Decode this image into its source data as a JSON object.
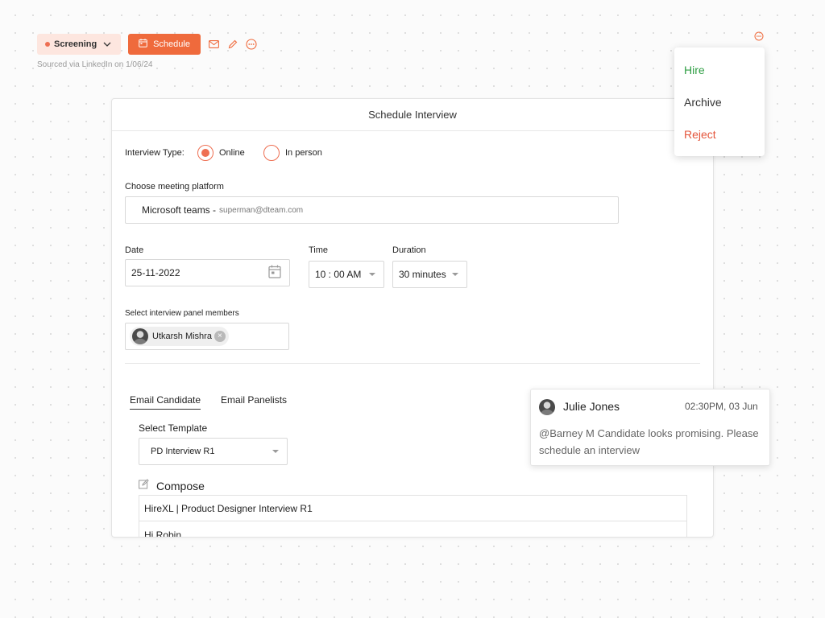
{
  "toolbar": {
    "status_label": "Screening",
    "schedule_label": "Schedule",
    "sourced_text": "Sourced via LinkedIn on 1/06/24"
  },
  "action_menu": {
    "items": [
      {
        "label": "Hire",
        "color": "#2f9e44"
      },
      {
        "label": "Archive",
        "color": "#333333"
      },
      {
        "label": "Reject",
        "color": "#e4553b"
      }
    ]
  },
  "schedule_card": {
    "title": "Schedule Interview",
    "interview_type": {
      "label": "Interview Type:",
      "options": [
        {
          "label": "Online",
          "selected": true
        },
        {
          "label": "In person",
          "selected": false
        }
      ]
    },
    "platform": {
      "label": "Choose meeting platform",
      "value": "Microsoft teams -",
      "email": "superman@dteam.com"
    },
    "date": {
      "label": "Date",
      "value": "25-11-2022"
    },
    "time": {
      "label": "Time",
      "value": "10 : 00 AM"
    },
    "duration": {
      "label": "Duration",
      "value": "30 minutes"
    },
    "panel": {
      "label": "Select interview panel members",
      "members": [
        {
          "name": "Utkarsh Mishra"
        }
      ]
    },
    "tabs": [
      {
        "label": "Email Candidate",
        "active": true
      },
      {
        "label": "Email Panelists",
        "active": false
      }
    ],
    "template": {
      "label": "Select Template",
      "value": "PD Interview R1"
    },
    "compose": {
      "label": "Compose",
      "subject": "HireXL | Product Designer Interview R1",
      "body_first_line": "Hi Robin."
    }
  },
  "comment": {
    "author": "Julie Jones",
    "time": "02:30PM, 03 Jun",
    "text": "@Barney M Candidate looks promising. Please schedule an interview"
  },
  "colors": {
    "accent": "#ef6a3c",
    "status_bg": "#fde6df",
    "hire": "#2f9e44",
    "reject": "#e4553b"
  },
  "icons": [
    "chevron-down-icon",
    "calendar-icon",
    "mail-icon",
    "pencil-icon",
    "more-icon",
    "calendar-picker-icon",
    "close-icon",
    "edit-icon",
    "user-avatar"
  ]
}
